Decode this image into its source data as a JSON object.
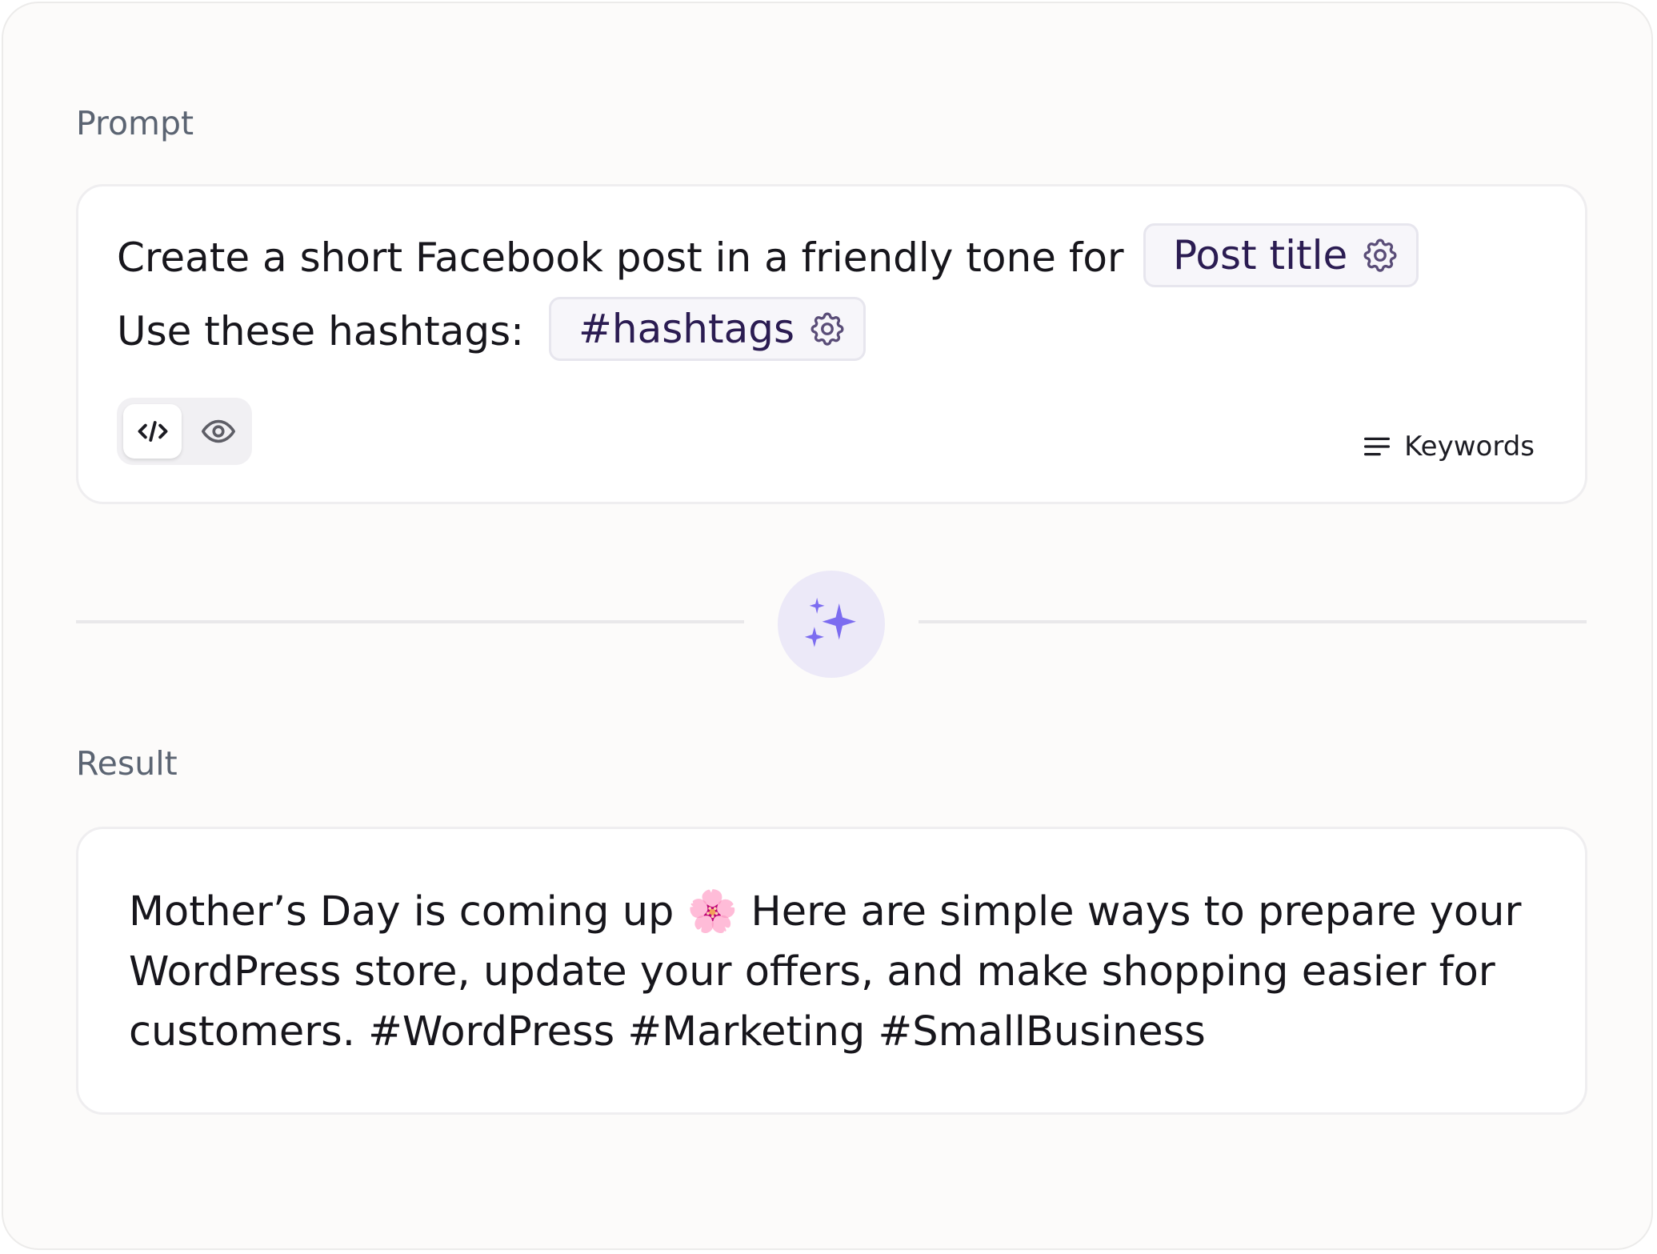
{
  "prompt": {
    "label": "Prompt",
    "line1_text": "Create a short Facebook post in a friendly tone for",
    "line1_chip": "Post title",
    "line2_text": "Use these hashtags:",
    "line2_chip": "#hashtags",
    "view_toggle": {
      "selected": "code",
      "options": [
        "code-icon",
        "eye-icon"
      ]
    },
    "keywords_label": "Keywords"
  },
  "generate": {
    "icon": "sparkles-icon"
  },
  "result": {
    "label": "Result",
    "text": "Mother’s Day is coming up 🌸 Here are simple ways to prepare your WordPress store, update your offers, and make shopping easier for customers. #WordPress #Marketing #SmallBusiness"
  },
  "colors": {
    "accent": "#7c6cf0",
    "chip_text": "#2b1c52",
    "sparkle_bg": "#ece9f8"
  }
}
